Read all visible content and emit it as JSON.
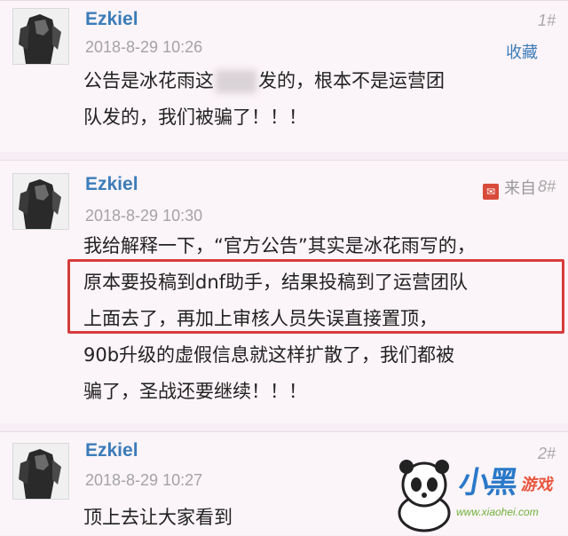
{
  "posts": [
    {
      "username": "Ezkiel",
      "timestamp": "2018-8-29 10:26",
      "floor": "1#",
      "action": "收藏",
      "lines": [
        [
          "公告是冰花雨这",
          "发的，根本不是运营团"
        ],
        "队发的，我们被骗了！！！"
      ]
    },
    {
      "username": "Ezkiel",
      "timestamp": "2018-8-29 10:30",
      "source": "来自",
      "floor": "8#",
      "lines": [
        "我给解释一下，“官方公告”其实是冰花雨写的，",
        "原本要投稿到dnf助手，结果投稿到了运营团队",
        "上面去了，再加上审核人员失误直接置顶，",
        "90b升级的虚假信息就这样扩散了，我们都被",
        "骗了，圣战还要继续！！！"
      ]
    },
    {
      "username": "Ezkiel",
      "timestamp": "2018-8-29 10:27",
      "floor": "2#",
      "lines": [
        "顶上去让大家看到"
      ]
    }
  ],
  "watermark": {
    "brand": "小黑",
    "brand_suffix": "游戏",
    "domain": "www.xiaohei.com"
  },
  "colors": {
    "username": "#3b7cb9",
    "timestamp": "#a4a4a4",
    "highlight_border": "#d63c3c",
    "background": "#fbf4f8"
  }
}
